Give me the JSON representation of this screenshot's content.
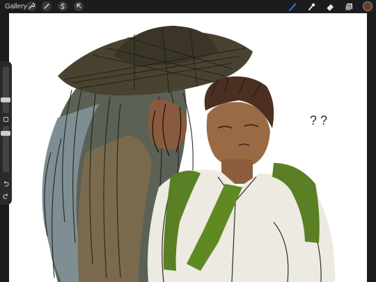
{
  "app": {
    "gallery_label": "Gallery"
  },
  "toolbar_left": [
    {
      "name": "actions-wrench",
      "icon": "wrench-icon"
    },
    {
      "name": "adjustments",
      "icon": "magic-wand-icon"
    },
    {
      "name": "selection",
      "icon": "selection-s-icon"
    },
    {
      "name": "transform",
      "icon": "arrow-cursor-icon"
    }
  ],
  "toolbar_right": [
    {
      "name": "brush",
      "icon": "brush-icon",
      "active": true
    },
    {
      "name": "smudge",
      "icon": "smudge-icon",
      "active": false
    },
    {
      "name": "eraser",
      "icon": "eraser-icon",
      "active": false
    },
    {
      "name": "layers",
      "icon": "layers-icon",
      "active": false
    }
  ],
  "colors": {
    "active_tool": "#3a7bd5",
    "current_color": "#6a3a2a",
    "toolbar_bg": "#1c1c1e"
  },
  "sidebar": {
    "brush_size": 0.3,
    "brush_opacity": 0.5,
    "undo_icon": "undo-icon",
    "redo_icon": "redo-icon",
    "modify_icon": "square-icon"
  },
  "canvas": {
    "artwork": "sketch"
  }
}
